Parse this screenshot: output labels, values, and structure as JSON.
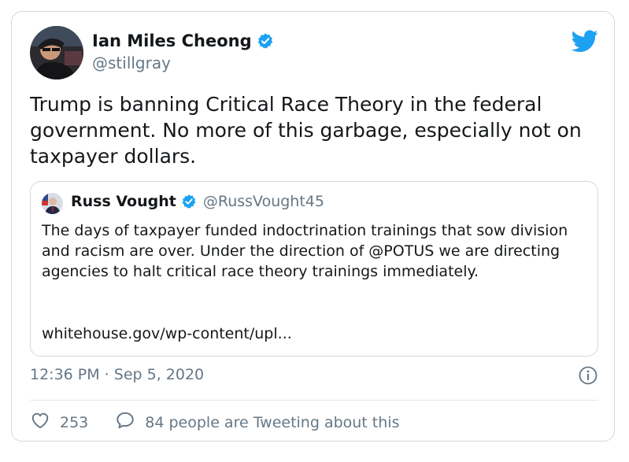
{
  "author": {
    "display_name": "Ian Miles Cheong",
    "handle": "@stillgray",
    "verified": true
  },
  "tweet": {
    "text": "Trump is banning Critical Race Theory in the federal government. No more of this garbage, especially not on taxpayer dollars."
  },
  "quoted_tweet": {
    "display_name": "Russ Vought",
    "handle": "@RussVought45",
    "verified": true,
    "text": "The days of taxpayer funded indoctrination trainings that sow division and racism are over. Under the direction of @POTUS we are directing agencies to halt critical race theory trainings immediately.",
    "link": "whitehouse.gov/wp-content/upl..."
  },
  "meta": {
    "timestamp": "12:36 PM · Sep 5, 2020"
  },
  "actions": {
    "likes": "253",
    "retweets_label": "84 people are Tweeting about this"
  },
  "icons": {
    "bird": "twitter-bird-icon",
    "verified": "verified-badge-icon",
    "info": "info-icon",
    "like": "heart-icon",
    "reply": "speech-bubble-icon"
  },
  "colors": {
    "twitter_blue": "#1da1f2",
    "secondary_text": "#657786",
    "border": "#cfd9de"
  }
}
